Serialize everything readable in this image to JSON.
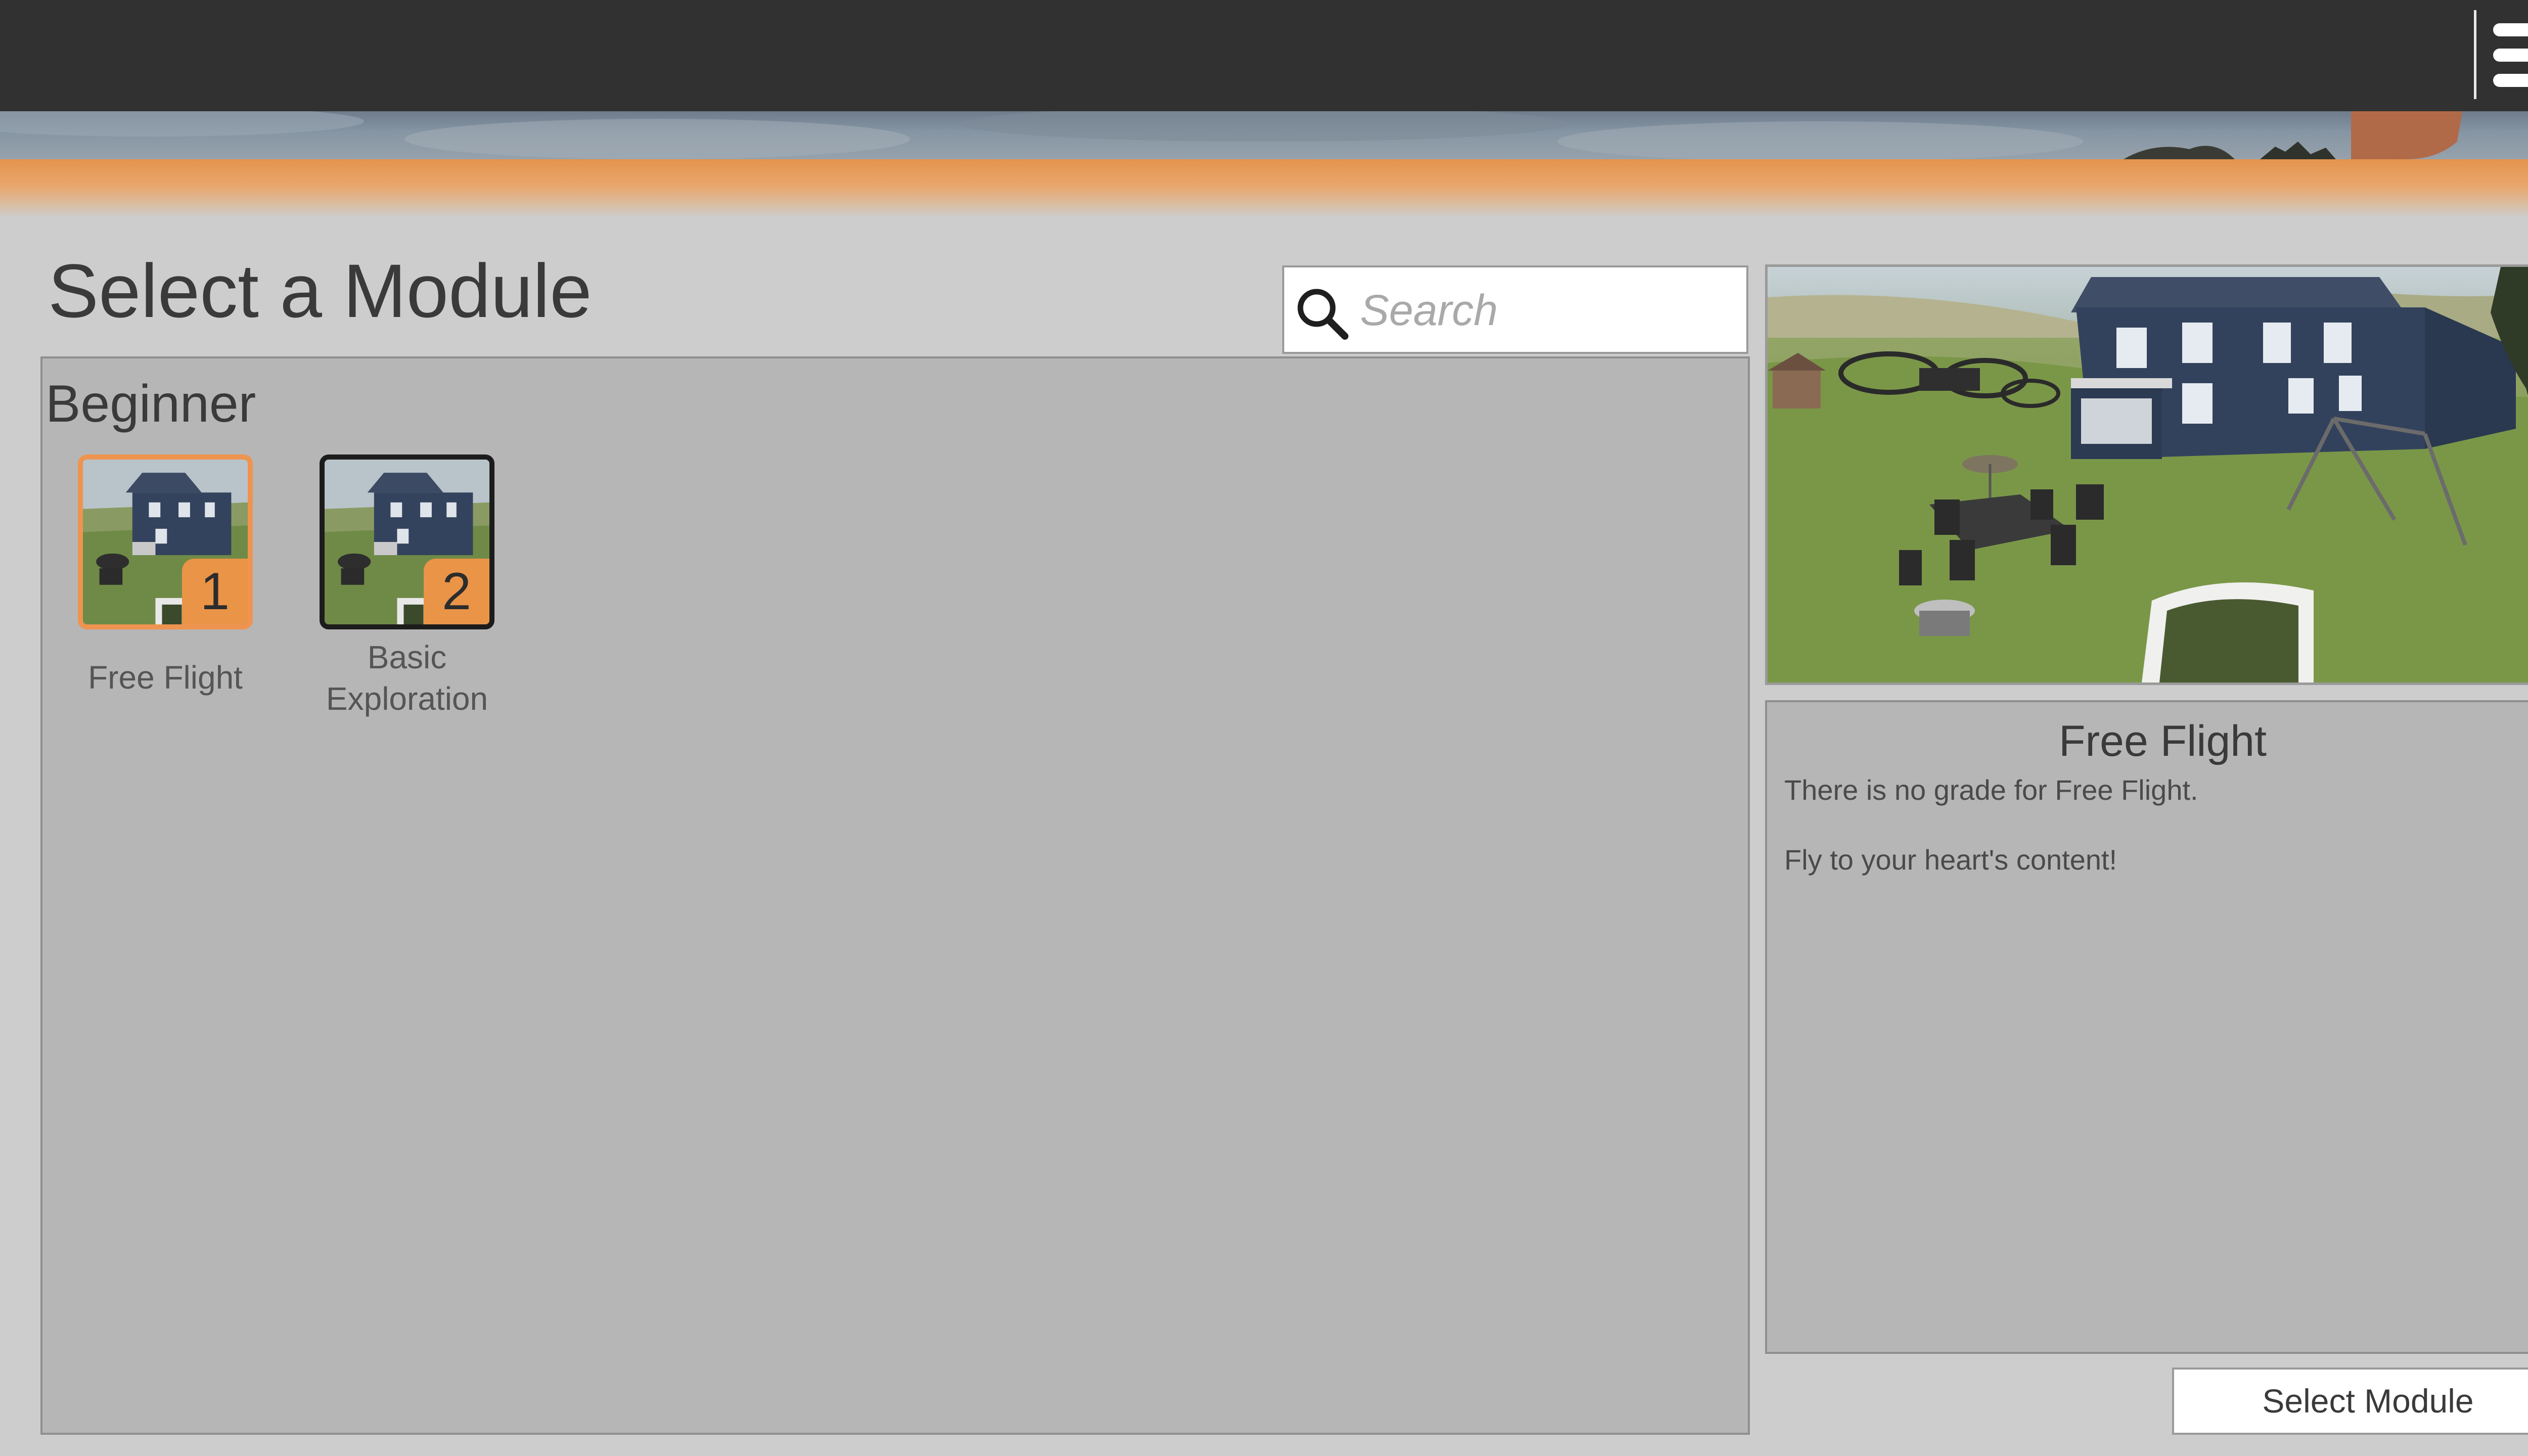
{
  "header": {
    "menu_icon": "hamburger-menu-icon"
  },
  "page": {
    "title": "Select a Module"
  },
  "search": {
    "placeholder": "Search",
    "icon": "search-icon"
  },
  "categories": [
    {
      "label": "Beginner",
      "modules": [
        {
          "number": "1",
          "name": "Free Flight",
          "selected": true
        },
        {
          "number": "2",
          "name_line1": "Basic",
          "name_line2": "Exploration",
          "selected": false
        }
      ]
    }
  ],
  "details": {
    "title": "Free Flight",
    "line1": "There is no grade for Free Flight.",
    "line2": "Fly to your heart's content!"
  },
  "actions": {
    "select_label": "Select Module"
  },
  "colors": {
    "accent": "#ea9448",
    "topbar": "#313131",
    "panel": "#b6b6b6",
    "background": "#cdcdcd"
  }
}
